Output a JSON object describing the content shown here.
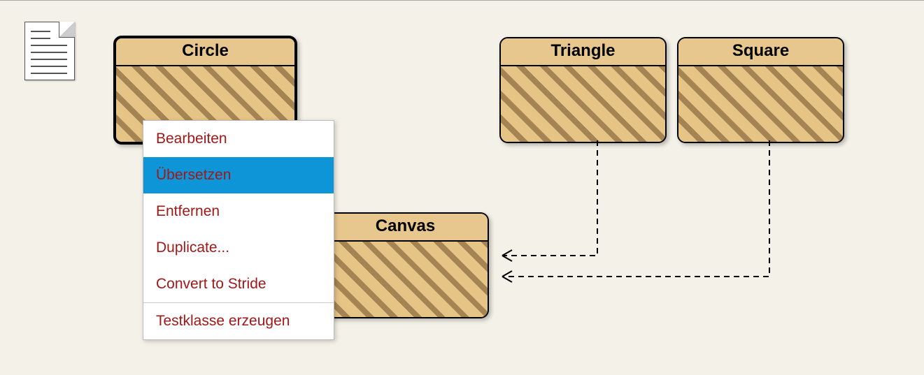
{
  "classes": {
    "circle": {
      "title": "Circle"
    },
    "triangle": {
      "title": "Triangle"
    },
    "square": {
      "title": "Square"
    },
    "canvas": {
      "title": "Canvas"
    }
  },
  "context_menu": {
    "items": [
      {
        "label": "Bearbeiten"
      },
      {
        "label": "Übersetzen"
      },
      {
        "label": "Entfernen"
      },
      {
        "label": "Duplicate..."
      },
      {
        "label": "Convert to Stride"
      },
      {
        "label": "Testklasse erzeugen"
      }
    ],
    "selected_index": 1
  }
}
